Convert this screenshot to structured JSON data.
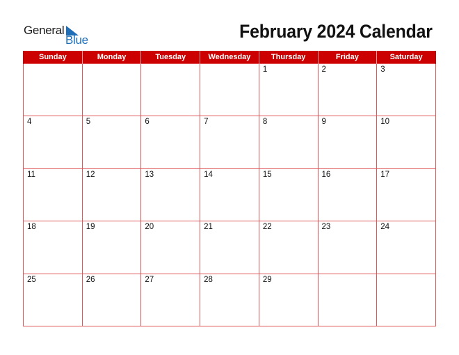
{
  "logo": {
    "line1": "General",
    "line2": "Blue",
    "brand_color": "#1f6fb8"
  },
  "header": {
    "title": "February 2024 Calendar"
  },
  "colors": {
    "header_bg": "#cc0000",
    "grid_line": "#e0575a"
  },
  "calendar": {
    "weekdays": [
      "Sunday",
      "Monday",
      "Tuesday",
      "Wednesday",
      "Thursday",
      "Friday",
      "Saturday"
    ],
    "weeks": [
      [
        "",
        "",
        "",
        "",
        "1",
        "2",
        "3"
      ],
      [
        "4",
        "5",
        "6",
        "7",
        "8",
        "9",
        "10"
      ],
      [
        "11",
        "12",
        "13",
        "14",
        "15",
        "16",
        "17"
      ],
      [
        "18",
        "19",
        "20",
        "21",
        "22",
        "23",
        "24"
      ],
      [
        "25",
        "26",
        "27",
        "28",
        "29",
        "",
        ""
      ]
    ]
  }
}
